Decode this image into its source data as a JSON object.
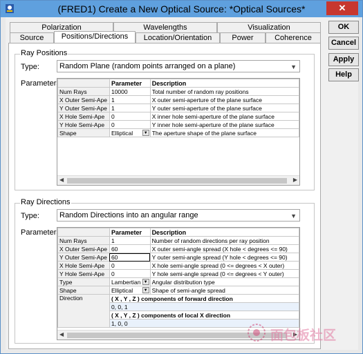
{
  "window": {
    "title": "(FRED1) Create a New Optical Source: *Optical Sources*",
    "close_label": "✕"
  },
  "tabs_row1": [
    "Polarization",
    "Wavelengths",
    "Visualization"
  ],
  "tabs_row2": [
    "Source",
    "Positions/Directions",
    "Location/Orientation",
    "Power",
    "Coherence"
  ],
  "buttons": {
    "ok": "OK",
    "cancel": "Cancel",
    "apply": "Apply",
    "help": "Help"
  },
  "ray_positions": {
    "group_label": "Ray Positions",
    "type_label": "Type:",
    "type_value": "Random Plane (random points arranged on a plane)",
    "params_label": "Parameters:",
    "headers": [
      "Parameter",
      "Description"
    ],
    "rows": [
      {
        "name": "Num Rays",
        "value": "10000",
        "desc": "Total number of random ray positions"
      },
      {
        "name": "X Outer Semi-Ape",
        "value": "1",
        "desc": "X outer semi-aperture of the plane surface"
      },
      {
        "name": "Y Outer Semi-Ape",
        "value": "1",
        "desc": "Y outer semi-aperture of the plane surface"
      },
      {
        "name": "X Hole Semi-Ape",
        "value": "0",
        "desc": "X inner hole semi-aperture of the plane surface"
      },
      {
        "name": "Y Hole Semi-Ape",
        "value": "0",
        "desc": "Y inner hole semi-aperture of the plane surface"
      },
      {
        "name": "Shape",
        "value": "Elliptical",
        "desc": "The aperture shape of the plane surface"
      }
    ]
  },
  "ray_directions": {
    "group_label": "Ray Directions",
    "type_label": "Type:",
    "type_value": "Random Directions into an angular range",
    "params_label": "Parameters:",
    "headers": [
      "Parameter",
      "Description"
    ],
    "rows": [
      {
        "name": "Num Rays",
        "value": "1",
        "desc": "Number of random directions per ray position"
      },
      {
        "name": "X Outer Semi-Ape",
        "value": "60",
        "desc": "X outer semi-angle spread (X hole < degrees <= 90)"
      },
      {
        "name": "Y Outer Semi-Ape",
        "value": "60",
        "desc": "Y outer semi-angle spread (Y hole < degrees <= 90)"
      },
      {
        "name": "X Hole Semi-Ape",
        "value": "0",
        "desc": "X hole semi-angle spread (0 <= degrees < X outer)"
      },
      {
        "name": "Y Hole Semi-Ape",
        "value": "0",
        "desc": "Y hole semi-angle spread (0 <= degrees < Y outer)"
      },
      {
        "name": "Type",
        "value": "Lambertian",
        "desc": "Angular distribution type"
      },
      {
        "name": "Shape",
        "value": "Elliptical",
        "desc": "Shape of semi-angle spread"
      }
    ],
    "direction": {
      "name": "Direction",
      "forward_header": "( X , Y , Z ) components of forward direction",
      "forward_value": "0,  0,  1",
      "local_x_header": "( X , Y , Z ) components of local X direction",
      "local_x_value": "1,  0,  0"
    }
  },
  "watermark_text": "面包板社区"
}
